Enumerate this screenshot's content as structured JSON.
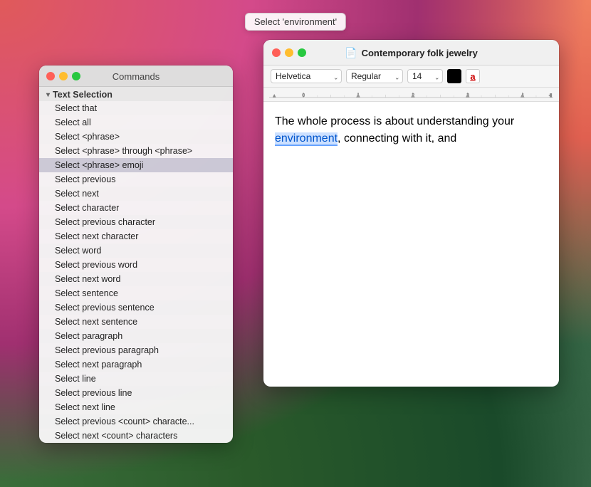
{
  "wallpaper": {},
  "tooltip": {
    "label": "Select 'environment'"
  },
  "commands_window": {
    "title": "Commands",
    "section": {
      "label": "Text Selection"
    },
    "items": [
      {
        "label": "Select that",
        "highlighted": false
      },
      {
        "label": "Select all",
        "highlighted": false
      },
      {
        "label": "Select <phrase>",
        "highlighted": false
      },
      {
        "label": "Select <phrase> through <phrase>",
        "highlighted": false
      },
      {
        "label": "Select <phrase> emoji",
        "highlighted": true
      },
      {
        "label": "Select previous",
        "highlighted": false
      },
      {
        "label": "Select next",
        "highlighted": false
      },
      {
        "label": "Select character",
        "highlighted": false
      },
      {
        "label": "Select previous character",
        "highlighted": false
      },
      {
        "label": "Select next character",
        "highlighted": false
      },
      {
        "label": "Select word",
        "highlighted": false
      },
      {
        "label": "Select previous word",
        "highlighted": false
      },
      {
        "label": "Select next word",
        "highlighted": false
      },
      {
        "label": "Select sentence",
        "highlighted": false
      },
      {
        "label": "Select previous sentence",
        "highlighted": false
      },
      {
        "label": "Select next sentence",
        "highlighted": false
      },
      {
        "label": "Select paragraph",
        "highlighted": false
      },
      {
        "label": "Select previous paragraph",
        "highlighted": false
      },
      {
        "label": "Select next paragraph",
        "highlighted": false
      },
      {
        "label": "Select line",
        "highlighted": false
      },
      {
        "label": "Select previous line",
        "highlighted": false
      },
      {
        "label": "Select next line",
        "highlighted": false
      },
      {
        "label": "Select previous <count> characte...",
        "highlighted": false
      },
      {
        "label": "Select next <count> characters",
        "highlighted": false
      }
    ]
  },
  "editor_window": {
    "title": "Contemporary folk jewelry",
    "doc_icon": "📄",
    "toolbar": {
      "font": "Helvetica",
      "style": "Regular",
      "size": "14",
      "font_placeholder": "Helvetica",
      "style_placeholder": "Regular",
      "size_placeholder": "14"
    },
    "content": {
      "text_before": "The whole process is about understanding your ",
      "highlighted": "environment",
      "text_after": ", connecting with it, and"
    }
  }
}
